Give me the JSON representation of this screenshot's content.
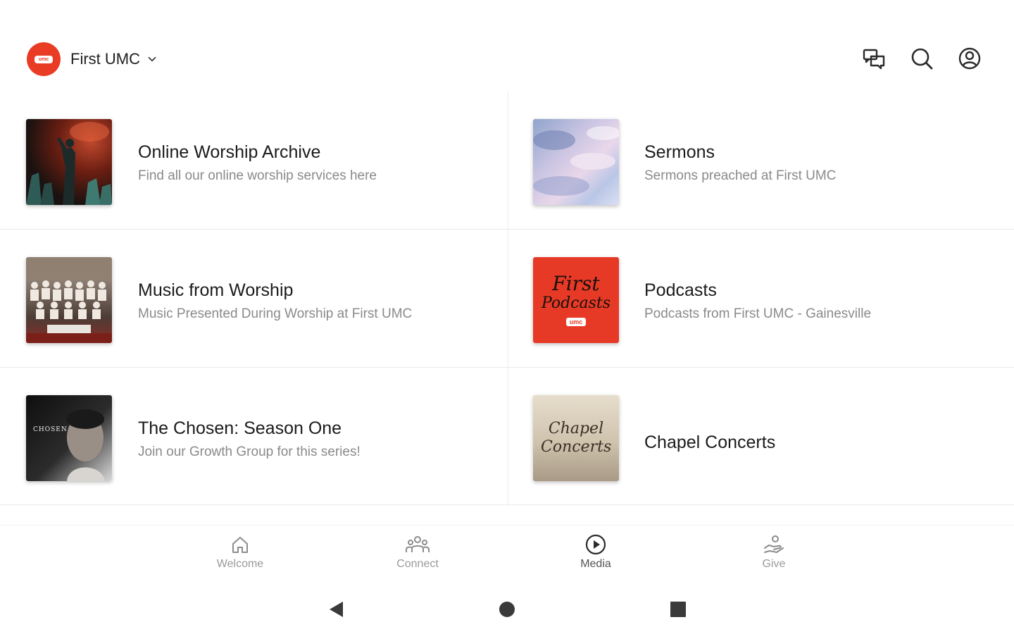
{
  "header": {
    "church_name": "First UMC",
    "logo_text": "umc",
    "icons": [
      "chevron-down-icon",
      "messages-icon",
      "search-icon",
      "account-icon"
    ]
  },
  "tiles": [
    {
      "title": "Online Worship Archive",
      "subtitle": "Find all our online worship services here"
    },
    {
      "title": "Sermons",
      "subtitle": "Sermons preached at First UMC"
    },
    {
      "title": "Music from Worship",
      "subtitle": "Music Presented During Worship at First UMC"
    },
    {
      "title": "Podcasts",
      "subtitle": "Podcasts from First UMC - Gainesville",
      "thumb_text_1": "First",
      "thumb_text_2": "Podcasts",
      "thumb_text_3": "umc"
    },
    {
      "title": "The Chosen: Season One",
      "subtitle": "Join our Growth Group for this series!",
      "thumb_text": "CHOSEN"
    },
    {
      "title": "Chapel Concerts",
      "subtitle": "",
      "thumb_text": "Chapel Concerts"
    }
  ],
  "bottom_nav": {
    "items": [
      {
        "label": "Welcome",
        "icon": "home-icon"
      },
      {
        "label": "Connect",
        "icon": "people-icon"
      },
      {
        "label": "Media",
        "icon": "play-circle-icon",
        "active": true
      },
      {
        "label": "Give",
        "icon": "give-hand-icon"
      }
    ]
  },
  "system_bar": {
    "icons": [
      "back-icon",
      "home-circle-icon",
      "recents-icon"
    ]
  },
  "colors": {
    "brand": "#ea3b24",
    "title": "#1b1b1b",
    "subtitle": "#8a8a8a",
    "nav_label": "#9a9a9a"
  }
}
